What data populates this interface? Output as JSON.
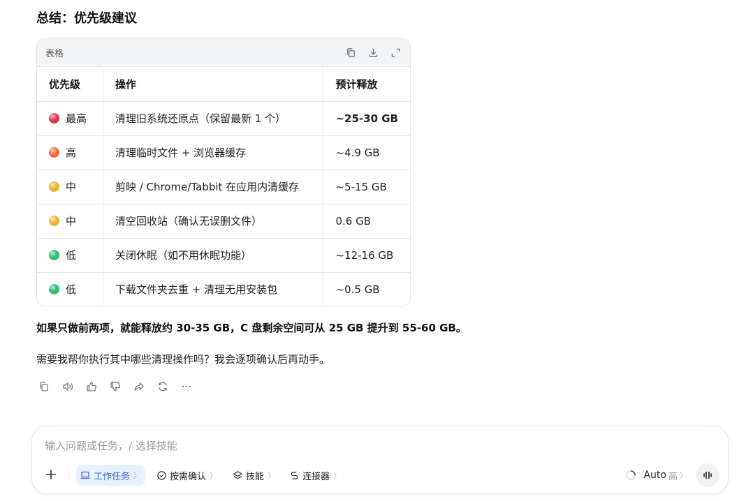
{
  "heading": "总结：优先级建议",
  "table": {
    "title": "表格",
    "tools": [
      "copy-icon",
      "download-icon",
      "expand-icon"
    ],
    "headers": [
      "优先级",
      "操作",
      "预计释放"
    ],
    "rows": [
      {
        "priority": "最高",
        "color": "#e0334f",
        "action": "清理旧系统还原点（保留最新 1 个）",
        "release": "~25-30 GB",
        "bold": true
      },
      {
        "priority": "高",
        "color": "#f06a3c",
        "action": "清理临时文件 + 浏览器缓存",
        "release": "~4.9 GB",
        "bold": false
      },
      {
        "priority": "中",
        "color": "#e8b530",
        "action": "剪映 / Chrome/Tabbit 在应用内清缓存",
        "release": "~5-15 GB",
        "bold": false
      },
      {
        "priority": "中",
        "color": "#e8b530",
        "action": "清空回收站（确认无误删文件）",
        "release": "0.6 GB",
        "bold": false
      },
      {
        "priority": "低",
        "color": "#2fbf71",
        "action": "关闭休眠（如不用休眠功能）",
        "release": "~12-16 GB",
        "bold": false
      },
      {
        "priority": "低",
        "color": "#2fbf71",
        "action": "下载文件夹去重 + 清理无用安装包",
        "release": "~0.5 GB",
        "bold": false
      }
    ]
  },
  "summary": "如果只做前两项，就能释放约 30-35 GB，C 盘剩余空间可从 25 GB 提升到 55-60 GB。",
  "followup": "需要我帮你执行其中哪些清理操作吗？我会逐项确认后再动手。",
  "message_actions": [
    "copy-icon",
    "speaker-icon",
    "thumbs-up-icon",
    "thumbs-down-icon",
    "share-icon",
    "regenerate-icon",
    "more-icon"
  ],
  "composer": {
    "placeholder": "输入问题或任务，/ 选择技能",
    "chips": {
      "work_task": "工作任务",
      "confirm": "按需确认",
      "skills": "技能",
      "connectors": "连接器"
    },
    "model": "Auto",
    "level": "高",
    "accent": "#2f6be0"
  }
}
